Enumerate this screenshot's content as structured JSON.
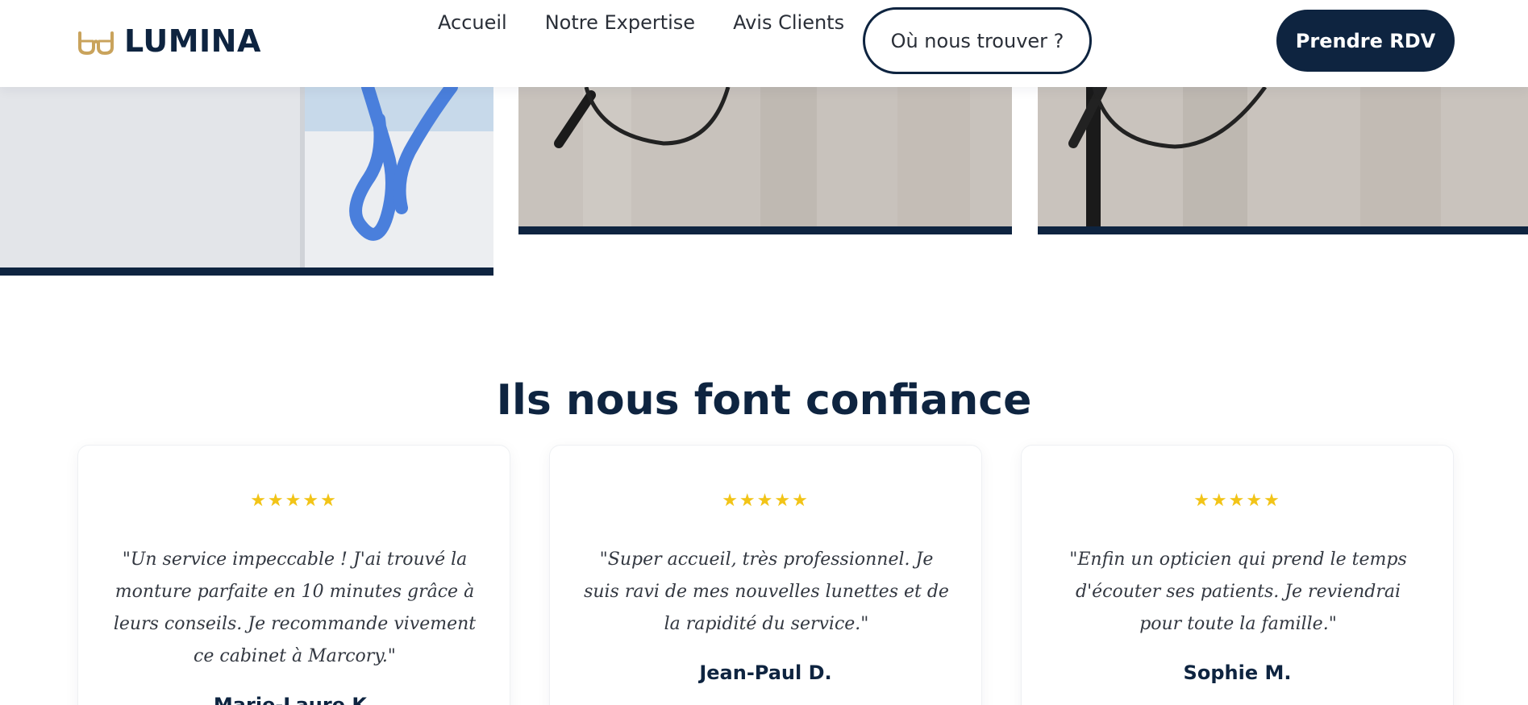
{
  "brand": {
    "name": "LUMINA",
    "icon": "glasses-icon",
    "accent": "#c9a35c",
    "primary": "#0e2440"
  },
  "nav": {
    "items": [
      "Accueil",
      "Notre Expertise",
      "Avis Clients"
    ]
  },
  "header": {
    "find_label": "Où nous trouver ?",
    "rdv_label": "Prendre RDV"
  },
  "gallery": {
    "accent_bar": "#0e2440"
  },
  "testimonials": {
    "title": "Ils nous font confiance",
    "star_color": "#f2c417",
    "items": [
      {
        "stars": "★★★★★",
        "rating": 5,
        "quote": "\"Un service impeccable ! J'ai trouvé la monture parfaite en 10 minutes grâce à leurs conseils. Je recommande vivement ce cabinet à Marcory.\"",
        "author": "Marie-Laure K."
      },
      {
        "stars": "★★★★★",
        "rating": 5,
        "quote": "\"Super accueil, très professionnel. Je suis ravi de mes nouvelles lunettes et de la rapidité du service.\"",
        "author": "Jean-Paul D."
      },
      {
        "stars": "★★★★★",
        "rating": 5,
        "quote": "\"Enfin un opticien qui prend le temps d'écouter ses patients. Je reviendrai pour toute la famille.\"",
        "author": "Sophie M."
      }
    ]
  }
}
